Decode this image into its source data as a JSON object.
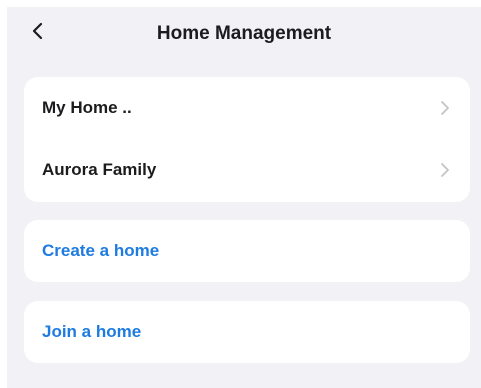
{
  "header": {
    "title": "Home Management",
    "back_icon": "chevron-left-icon"
  },
  "homes": [
    {
      "name": "My Home ..",
      "icon": "chevron-right-icon"
    },
    {
      "name": "Aurora Family",
      "icon": "chevron-right-icon"
    }
  ],
  "actions": {
    "create_label": "Create a home",
    "join_label": "Join a home"
  },
  "colors": {
    "background": "#f2f2f6",
    "card": "#ffffff",
    "text": "#1c1c1e",
    "accent": "#1e7ce0",
    "chevron": "#c4c4c8"
  }
}
